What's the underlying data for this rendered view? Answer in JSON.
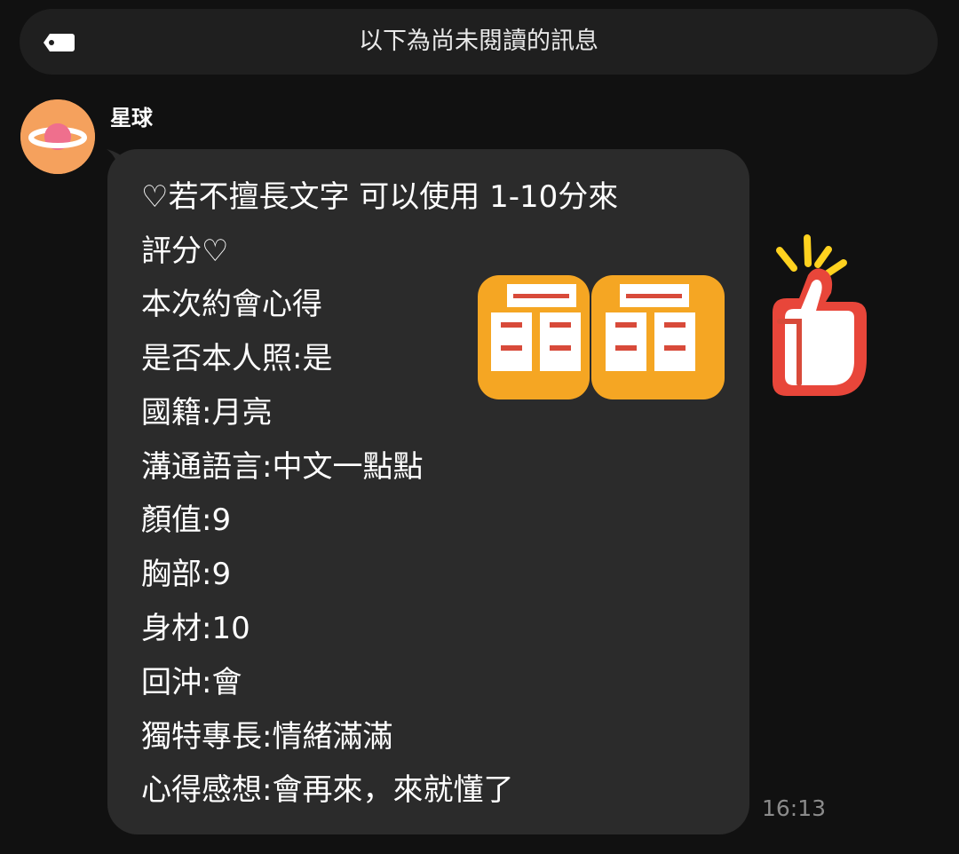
{
  "unread_divider": {
    "label": "以下為尚未閱讀的訊息",
    "icon": "label-tag-icon"
  },
  "message": {
    "sender": {
      "name": "星球",
      "avatar_icon": "planet-icon",
      "avatar_color": "#f5a15d"
    },
    "lines": [
      "♡若不擅長文字 可以使用 1-10分來",
      "評分♡",
      "本次約會心得",
      "是否本人照:是",
      "國籍:月亮",
      "溝通語言:中文一點點",
      "顏值:9",
      "胸部:9",
      "身材:10",
      "回沖:會",
      "獨特專長:情緒滿滿",
      "心得感想:會再來，來就懂了"
    ],
    "timestamp": "16:13"
  },
  "sticker": {
    "text": "晶晶",
    "icons": [
      "thumbs-up-icon"
    ],
    "colors": {
      "orange": "#f5a623",
      "red": "#e8463a",
      "white": "#ffffff",
      "yellow": "#ffd21f"
    }
  },
  "theme": {
    "background": "#111111",
    "bubble": "#2b2b2b",
    "divider": "#1f1f1f",
    "text": "#ffffff",
    "muted_text": "#8b8b8b"
  }
}
